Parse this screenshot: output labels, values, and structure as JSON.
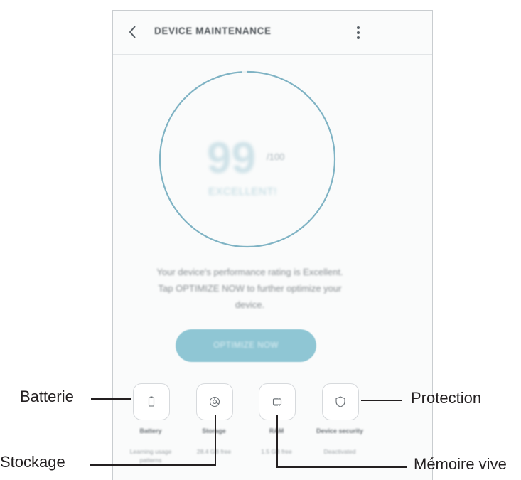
{
  "app": {
    "title": "DEVICE MAINTENANCE",
    "icons": {
      "back": "chevron-left-icon",
      "more": "more-vertical-icon"
    }
  },
  "score": {
    "value": "99",
    "max_label": "/100",
    "label": "EXCELLENT!",
    "ring_fraction": 0.99
  },
  "description": {
    "line1": "Your device's performance rating is Excellent.",
    "line2": "Tap OPTIMIZE NOW to further optimize your",
    "line3": "device."
  },
  "optimize_button": {
    "label": "OPTIMIZE NOW"
  },
  "features": [
    {
      "name": "Battery",
      "status": "Learning usage patterns",
      "icon": "battery-icon"
    },
    {
      "name": "Storage",
      "status": "28.4 GB free",
      "icon": "storage-icon"
    },
    {
      "name": "RAM",
      "status": "1.5 GB free",
      "icon": "ram-chip-icon"
    },
    {
      "name": "Device security",
      "status": "Deactivated",
      "icon": "shield-icon"
    }
  ],
  "callouts": {
    "battery": "Batterie",
    "storage": "Stockage",
    "security": "Protection",
    "ram": "Mémoire vive"
  },
  "colors": {
    "accent": "#8fc6d4",
    "ring": "#7fb3c4",
    "callout_text": "#231f20"
  }
}
